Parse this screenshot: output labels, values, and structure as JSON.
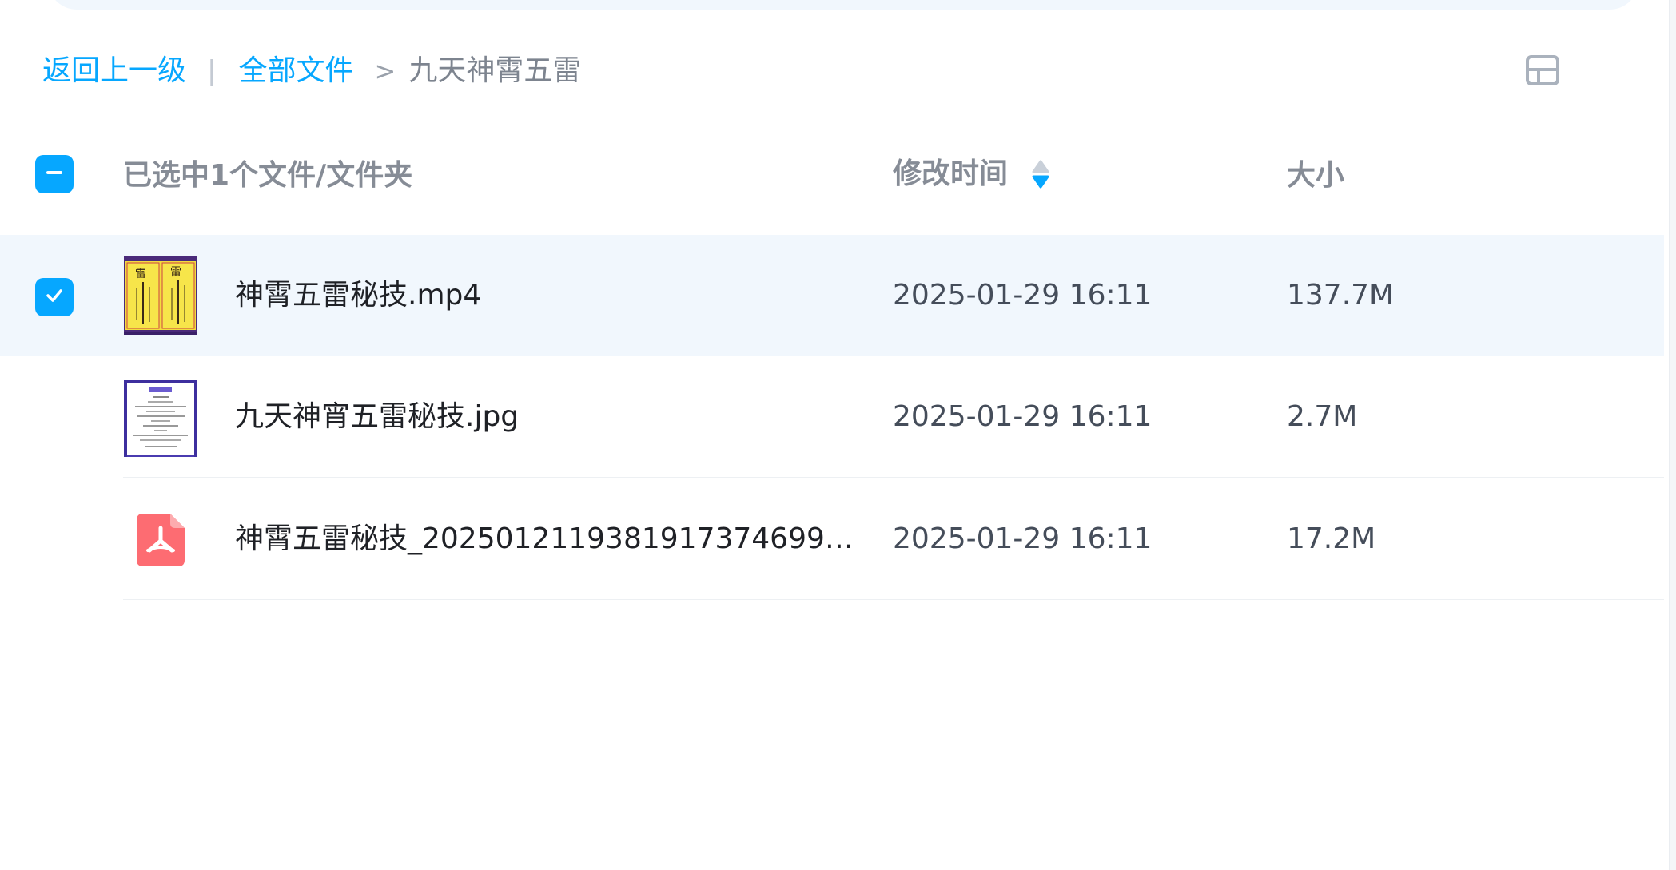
{
  "breadcrumb": {
    "back": "返回上一级",
    "separator": "|",
    "root": "全部文件",
    "arrow": ">",
    "current": "九天神霄五雷"
  },
  "header": {
    "selection_text": "已选中1个文件/文件夹",
    "col_time": "修改时间",
    "col_size": "大小"
  },
  "files": [
    {
      "name": "神霄五雷秘技.mp4",
      "time": "2025-01-29 16:11",
      "size": "137.7M",
      "selected": true,
      "type": "video"
    },
    {
      "name": "九天神宵五雷秘技.jpg",
      "time": "2025-01-29 16:11",
      "size": "2.7M",
      "selected": false,
      "type": "image"
    },
    {
      "name": "神霄五雷秘技_20250121193819173746993...",
      "time": "2025-01-29 16:11",
      "size": "17.2M",
      "selected": false,
      "type": "pdf"
    }
  ],
  "colors": {
    "accent": "#06a7ff",
    "selected_row_bg": "#f1f7fd",
    "pdf_icon": "#fd6c72"
  },
  "icons": {
    "view_toggle": "grid-view-icon",
    "sort": "sort-icon",
    "checkbox_partial": "minus-icon",
    "checkbox_checked": "check-icon",
    "pdf": "pdf-icon"
  }
}
